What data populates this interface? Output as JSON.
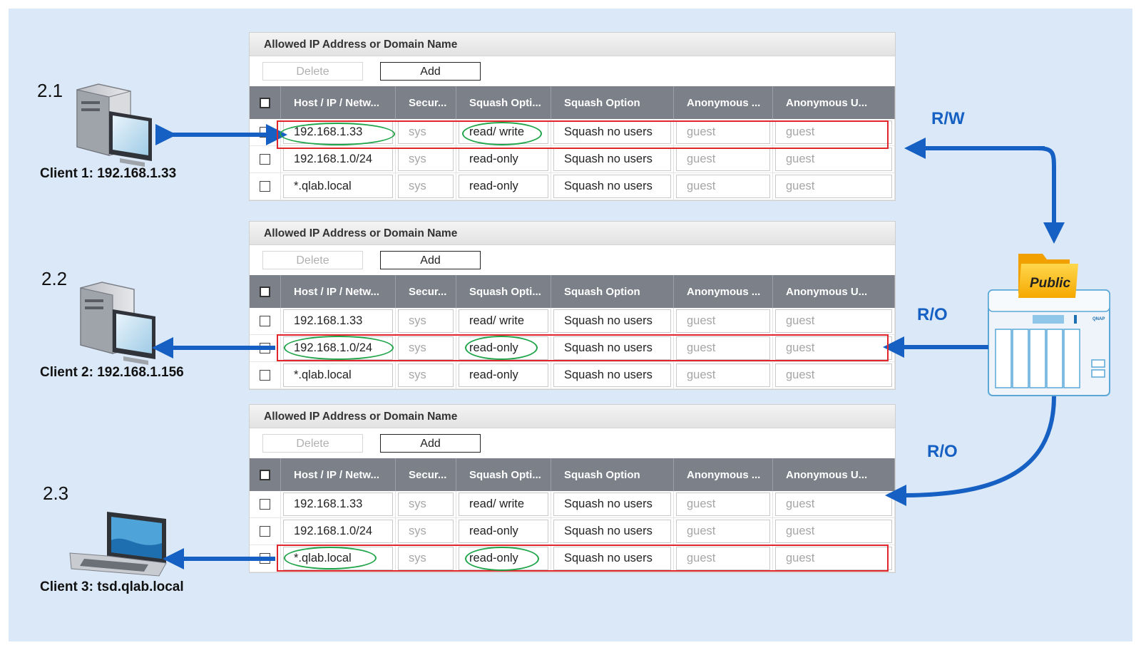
{
  "panel": {
    "title": "Allowed IP Address or Domain Name",
    "delete_label": "Delete",
    "add_label": "Add",
    "columns": [
      "Host / IP / Netw...",
      "Secur...",
      "Squash Opti...",
      "Squash Option",
      "Anonymous ...",
      "Anonymous U..."
    ]
  },
  "rows": [
    {
      "host": "192.168.1.33",
      "security": "sys",
      "access": "read/ write",
      "squash": "Squash no users",
      "anon_gid": "guest",
      "anon_uid": "guest"
    },
    {
      "host": "192.168.1.0/24",
      "security": "sys",
      "access": "read-only",
      "squash": "Squash no users",
      "anon_gid": "guest",
      "anon_uid": "guest"
    },
    {
      "host": "*.qlab.local",
      "security": "sys",
      "access": "read-only",
      "squash": "Squash no users",
      "anon_gid": "guest",
      "anon_uid": "guest"
    }
  ],
  "clients": [
    {
      "step": "2.1",
      "label": "Client 1: 192.168.1.33"
    },
    {
      "step": "2.2",
      "label": "Client 2: 192.168.1.156"
    },
    {
      "step": "2.3",
      "label": "Client 3: tsd.qlab.local"
    }
  ],
  "permissions": {
    "first": "R/W",
    "second": "R/O",
    "third": "R/O"
  },
  "nas": {
    "folder_label": "Public",
    "brand": "QNAP"
  },
  "colors": {
    "background": "#dbe8f8",
    "arrow": "#1560c2",
    "highlight_row": "#e0252b",
    "highlight_oval": "#21a54a",
    "table_header": "#7b8089"
  }
}
